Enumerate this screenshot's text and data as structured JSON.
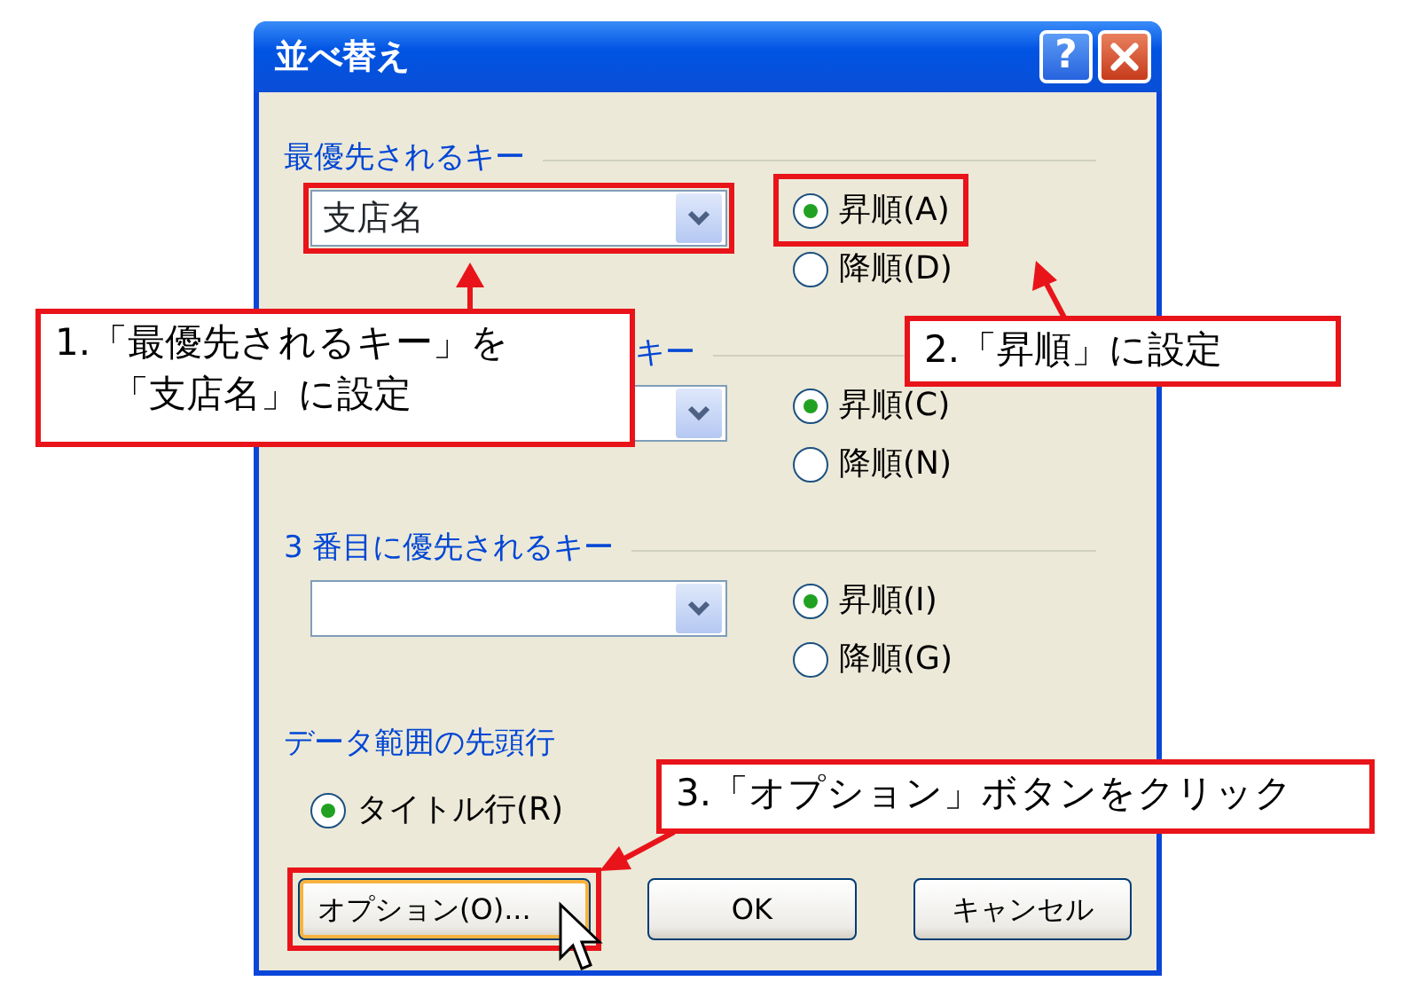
{
  "window": {
    "title": "並べ替え",
    "help_button": "?"
  },
  "groups": [
    {
      "label": "最優先されるキー",
      "dropdown": {
        "value": "支店名"
      },
      "options": [
        {
          "label": "昇順(A)",
          "selected": true
        },
        {
          "label": "降順(D)",
          "selected": false
        }
      ]
    },
    {
      "label": "キー",
      "label_covered": true,
      "options": [
        {
          "label": "昇順(C)",
          "selected": true
        },
        {
          "label": "降順(N)",
          "selected": false
        }
      ]
    },
    {
      "label": "3 番目に優先されるキー",
      "options": [
        {
          "label": "昇順(I)",
          "selected": true
        },
        {
          "label": "降順(G)",
          "selected": false
        }
      ]
    }
  ],
  "header_row": {
    "label": "データ範囲の先頭行",
    "options": [
      {
        "label": "タイトル行(R)",
        "selected": true
      }
    ]
  },
  "buttons": [
    {
      "label": "オプション(O)...",
      "focused": true
    },
    {
      "label": "OK",
      "focused": false
    },
    {
      "label": "キャンセル",
      "focused": false
    }
  ],
  "annotations": [
    {
      "lines": [
        "1.「最優先されるキー」を",
        "「支店名」に設定"
      ]
    },
    {
      "lines": [
        "2.「昇順」に設定"
      ]
    },
    {
      "lines": [
        "3.「オプション」ボタンをクリック"
      ]
    }
  ]
}
